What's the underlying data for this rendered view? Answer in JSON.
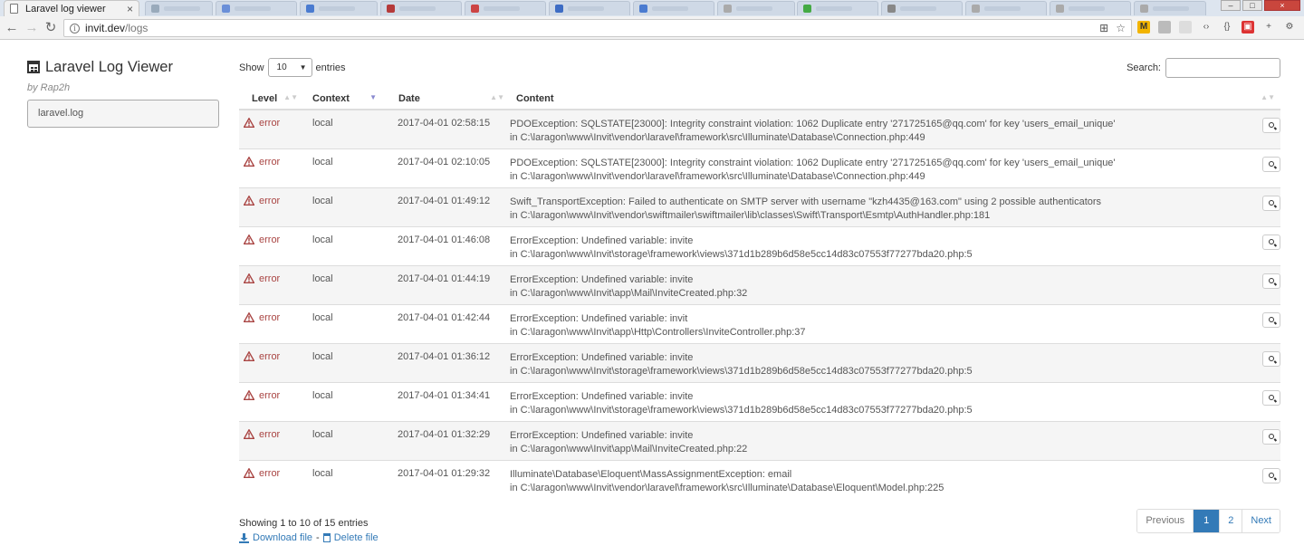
{
  "browser": {
    "active_tab_title": "Laravel log viewer",
    "url_host": "invit.dev",
    "url_path": "/logs"
  },
  "sidebar": {
    "title": "Laravel Log Viewer",
    "byline": "by Rap2h",
    "files": [
      "laravel.log"
    ]
  },
  "controls": {
    "show_label": "Show",
    "entries_label": "entries",
    "page_length": "10",
    "search_label": "Search:"
  },
  "table": {
    "headers": [
      "Level",
      "Context",
      "Date",
      "Content"
    ],
    "rows": [
      {
        "level": "error",
        "context": "local",
        "date": "2017-04-01 02:58:15",
        "message": "PDOException: SQLSTATE[23000]: Integrity constraint violation: 1062 Duplicate entry '271725165@qq.com' for key 'users_email_unique'",
        "location": "in C:\\laragon\\www\\Invit\\vendor\\laravel\\framework\\src\\Illuminate\\Database\\Connection.php:449"
      },
      {
        "level": "error",
        "context": "local",
        "date": "2017-04-01 02:10:05",
        "message": "PDOException: SQLSTATE[23000]: Integrity constraint violation: 1062 Duplicate entry '271725165@qq.com' for key 'users_email_unique'",
        "location": "in C:\\laragon\\www\\Invit\\vendor\\laravel\\framework\\src\\Illuminate\\Database\\Connection.php:449"
      },
      {
        "level": "error",
        "context": "local",
        "date": "2017-04-01 01:49:12",
        "message": "Swift_TransportException: Failed to authenticate on SMTP server with username \"kzh4435@163.com\" using 2 possible authenticators",
        "location": "in C:\\laragon\\www\\Invit\\vendor\\swiftmailer\\swiftmailer\\lib\\classes\\Swift\\Transport\\Esmtp\\AuthHandler.php:181"
      },
      {
        "level": "error",
        "context": "local",
        "date": "2017-04-01 01:46:08",
        "message": "ErrorException: Undefined variable: invite",
        "location": "in C:\\laragon\\www\\Invit\\storage\\framework\\views\\371d1b289b6d58e5cc14d83c07553f77277bda20.php:5"
      },
      {
        "level": "error",
        "context": "local",
        "date": "2017-04-01 01:44:19",
        "message": "ErrorException: Undefined variable: invite",
        "location": "in C:\\laragon\\www\\Invit\\app\\Mail\\InviteCreated.php:32"
      },
      {
        "level": "error",
        "context": "local",
        "date": "2017-04-01 01:42:44",
        "message": "ErrorException: Undefined variable: invit",
        "location": "in C:\\laragon\\www\\Invit\\app\\Http\\Controllers\\InviteController.php:37"
      },
      {
        "level": "error",
        "context": "local",
        "date": "2017-04-01 01:36:12",
        "message": "ErrorException: Undefined variable: invite",
        "location": "in C:\\laragon\\www\\Invit\\storage\\framework\\views\\371d1b289b6d58e5cc14d83c07553f77277bda20.php:5"
      },
      {
        "level": "error",
        "context": "local",
        "date": "2017-04-01 01:34:41",
        "message": "ErrorException: Undefined variable: invite",
        "location": "in C:\\laragon\\www\\Invit\\storage\\framework\\views\\371d1b289b6d58e5cc14d83c07553f77277bda20.php:5"
      },
      {
        "level": "error",
        "context": "local",
        "date": "2017-04-01 01:32:29",
        "message": "ErrorException: Undefined variable: invite",
        "location": "in C:\\laragon\\www\\Invit\\app\\Mail\\InviteCreated.php:22"
      },
      {
        "level": "error",
        "context": "local",
        "date": "2017-04-01 01:29:32",
        "message": "Illuminate\\Database\\Eloquent\\MassAssignmentException: email",
        "location": "in C:\\laragon\\www\\Invit\\vendor\\laravel\\framework\\src\\Illuminate\\Database\\Eloquent\\Model.php:225"
      }
    ]
  },
  "footer": {
    "info": "Showing 1 to 10 of 15 entries",
    "pagination": {
      "previous": "Previous",
      "pages": [
        "1",
        "2"
      ],
      "next": "Next"
    },
    "download_label": "Download file",
    "separator": "-",
    "delete_label": "Delete file"
  },
  "colors": {
    "error": "#a94442",
    "link": "#337ab7"
  }
}
